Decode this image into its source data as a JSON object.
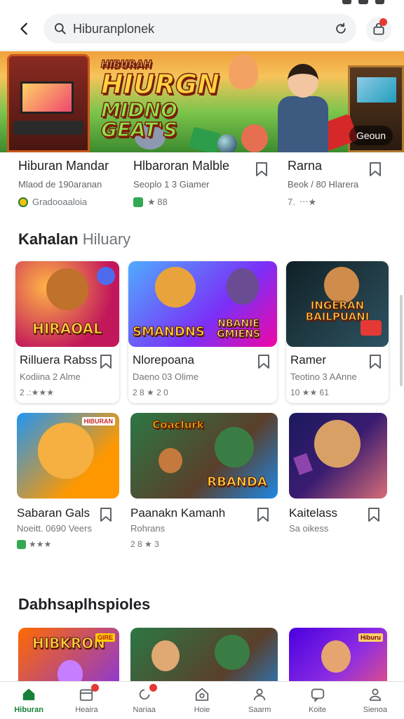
{
  "search": {
    "value": "Hiburanplonek"
  },
  "banner": {
    "line0": "HIBURAH",
    "line1": "HIURGN",
    "line2": "MIDNO GEAT'S",
    "badge": "Geoun"
  },
  "top_row": [
    {
      "title": "Hiburan Mandar",
      "subtitle": "Mlaod de 190aranan",
      "meta": "Gradooaaloia"
    },
    {
      "title": "Hlbaroran Malble",
      "subtitle": "Seoplo 1 3 Giamer",
      "meta": "★ 88"
    },
    {
      "title": "Rarna",
      "subtitle": "Beok / 80 Hlarera",
      "meta": "7.  ⋅⋅⋅★"
    }
  ],
  "section1": {
    "title_dark": "Kahalan",
    "title_light": "Hiluary"
  },
  "section2": {
    "title": "Dabhsaplhspioles"
  },
  "cards_row1": [
    {
      "title": "Rilluera Rabss",
      "subtitle": "Kodiina 2 Alme",
      "meta": "2 .:★★★",
      "thumb_label": "HIRAOAL"
    },
    {
      "title": "Nlorepoana",
      "subtitle": "Daeno 03 Olime",
      "meta": "2 8 ★ 2 0",
      "thumb_label_1": "SMANDNS",
      "thumb_label_2": "NBANIE GMIENS"
    },
    {
      "title": "Ramer",
      "subtitle": "Teotino 3 AAnne",
      "meta": "10 ★★ 61",
      "thumb_label": "INGERAN BAILPUANI"
    }
  ],
  "cards_row2": [
    {
      "title": "Sabaran Gals",
      "subtitle": "Noeitt. 0690 Veers",
      "meta": "★★★",
      "thumb_tag": "HIBURAN"
    },
    {
      "title": "Paanakn Kamanh",
      "subtitle": "Rohrans",
      "meta": "2 8 ★ 3",
      "thumb_label_1": "Coaclurk",
      "thumb_label_2": "RBANDA"
    },
    {
      "title": "Kaitelass",
      "subtitle": "Sa oikess",
      "meta": ""
    }
  ],
  "cards_row3": [
    {
      "thumb_label": "HIBKRON",
      "thumb_tag": "GIRE"
    },
    {},
    {
      "thumb_tag": "Hiburu"
    }
  ],
  "bottom_nav": [
    {
      "label": "Hiburan",
      "icon": "home-icon",
      "active": true
    },
    {
      "label": "Heaira",
      "icon": "calendar-icon"
    },
    {
      "label": "Nariaa",
      "icon": "refresh-icon"
    },
    {
      "label": "Hoie",
      "icon": "house-icon"
    },
    {
      "label": "Saarm",
      "icon": "person-icon"
    },
    {
      "label": "Koite",
      "icon": "chat-icon"
    },
    {
      "label": "Sienoa",
      "icon": "account-icon"
    }
  ],
  "colors": {
    "accent": "#188038",
    "badge": "#e53935"
  }
}
